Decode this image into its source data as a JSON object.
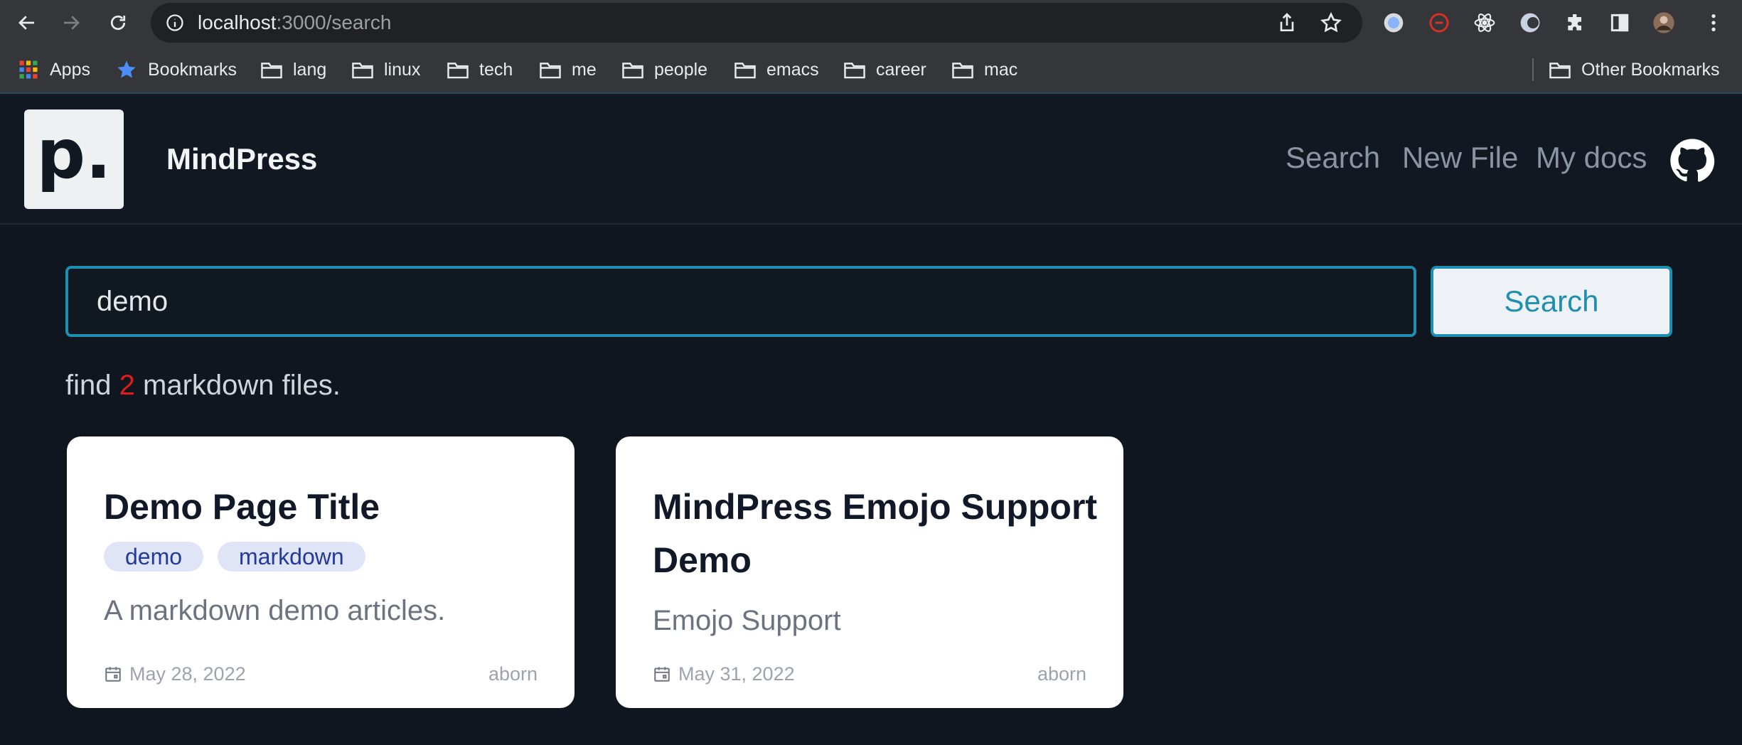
{
  "browser": {
    "url_host": "localhost",
    "url_path": ":3000/search",
    "bookmarks": [
      {
        "label": "Apps",
        "icon": "apps-grid-icon"
      },
      {
        "label": "Bookmarks",
        "icon": "star-icon"
      },
      {
        "label": "lang",
        "icon": "folder-icon"
      },
      {
        "label": "linux",
        "icon": "folder-icon"
      },
      {
        "label": "tech",
        "icon": "folder-icon"
      },
      {
        "label": "me",
        "icon": "folder-icon"
      },
      {
        "label": "people",
        "icon": "folder-icon"
      },
      {
        "label": "emacs",
        "icon": "folder-icon"
      },
      {
        "label": "career",
        "icon": "folder-icon"
      },
      {
        "label": "mac",
        "icon": "folder-icon"
      }
    ],
    "other_bookmarks": "Other Bookmarks"
  },
  "header": {
    "logo_text": "p.",
    "brand": "MindPress",
    "nav": [
      "Search",
      "New File",
      "My docs"
    ]
  },
  "search": {
    "value": "demo",
    "button_label": "Search"
  },
  "results": {
    "prefix": "find",
    "count": "2",
    "suffix": "markdown files."
  },
  "cards": [
    {
      "title": "Demo Page Title",
      "tags": [
        "demo",
        "markdown"
      ],
      "description": "A markdown demo articles.",
      "date": "May 28, 2022",
      "author": "aborn"
    },
    {
      "title": "MindPress Emojo Support Demo",
      "tags": [],
      "description": "Emojo Support",
      "date": "May 31, 2022",
      "author": "aborn"
    }
  ],
  "colors": {
    "accent": "#1e8fb0",
    "count": "#e21b1b",
    "page_bg": "#0f161f"
  }
}
